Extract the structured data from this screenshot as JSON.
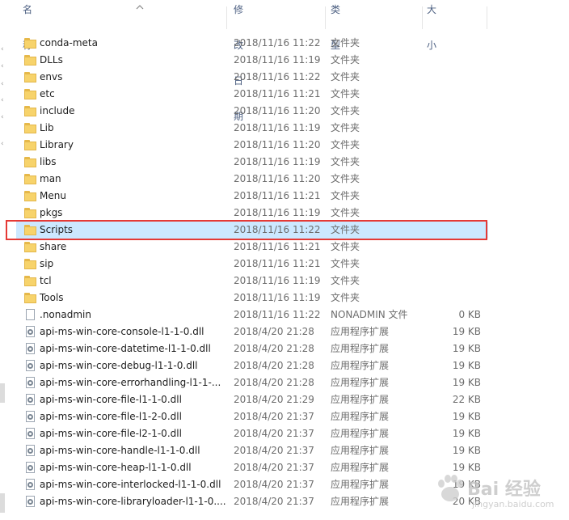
{
  "columns": {
    "name": "名称",
    "date": "修改日期",
    "type": "类型",
    "size": "大小"
  },
  "files": [
    {
      "name": "conda-meta",
      "date": "2018/11/16 11:22",
      "type": "文件夹",
      "size": "",
      "kind": "folder"
    },
    {
      "name": "DLLs",
      "date": "2018/11/16 11:19",
      "type": "文件夹",
      "size": "",
      "kind": "folder"
    },
    {
      "name": "envs",
      "date": "2018/11/16 11:22",
      "type": "文件夹",
      "size": "",
      "kind": "folder"
    },
    {
      "name": "etc",
      "date": "2018/11/16 11:21",
      "type": "文件夹",
      "size": "",
      "kind": "folder"
    },
    {
      "name": "include",
      "date": "2018/11/16 11:20",
      "type": "文件夹",
      "size": "",
      "kind": "folder"
    },
    {
      "name": "Lib",
      "date": "2018/11/16 11:19",
      "type": "文件夹",
      "size": "",
      "kind": "folder"
    },
    {
      "name": "Library",
      "date": "2018/11/16 11:20",
      "type": "文件夹",
      "size": "",
      "kind": "folder"
    },
    {
      "name": "libs",
      "date": "2018/11/16 11:19",
      "type": "文件夹",
      "size": "",
      "kind": "folder"
    },
    {
      "name": "man",
      "date": "2018/11/16 11:20",
      "type": "文件夹",
      "size": "",
      "kind": "folder"
    },
    {
      "name": "Menu",
      "date": "2018/11/16 11:21",
      "type": "文件夹",
      "size": "",
      "kind": "folder"
    },
    {
      "name": "pkgs",
      "date": "2018/11/16 11:19",
      "type": "文件夹",
      "size": "",
      "kind": "folder"
    },
    {
      "name": "Scripts",
      "date": "2018/11/16 11:22",
      "type": "文件夹",
      "size": "",
      "kind": "folder",
      "selected": true
    },
    {
      "name": "share",
      "date": "2018/11/16 11:21",
      "type": "文件夹",
      "size": "",
      "kind": "folder"
    },
    {
      "name": "sip",
      "date": "2018/11/16 11:21",
      "type": "文件夹",
      "size": "",
      "kind": "folder"
    },
    {
      "name": "tcl",
      "date": "2018/11/16 11:19",
      "type": "文件夹",
      "size": "",
      "kind": "folder"
    },
    {
      "name": "Tools",
      "date": "2018/11/16 11:19",
      "type": "文件夹",
      "size": "",
      "kind": "folder"
    },
    {
      "name": ".nonadmin",
      "date": "2018/11/16 11:22",
      "type": "NONADMIN 文件",
      "size": "0 KB",
      "kind": "file"
    },
    {
      "name": "api-ms-win-core-console-l1-1-0.dll",
      "date": "2018/4/20 21:28",
      "type": "应用程序扩展",
      "size": "19 KB",
      "kind": "dll"
    },
    {
      "name": "api-ms-win-core-datetime-l1-1-0.dll",
      "date": "2018/4/20 21:28",
      "type": "应用程序扩展",
      "size": "19 KB",
      "kind": "dll"
    },
    {
      "name": "api-ms-win-core-debug-l1-1-0.dll",
      "date": "2018/4/20 21:28",
      "type": "应用程序扩展",
      "size": "19 KB",
      "kind": "dll"
    },
    {
      "name": "api-ms-win-core-errorhandling-l1-1-...",
      "date": "2018/4/20 21:28",
      "type": "应用程序扩展",
      "size": "19 KB",
      "kind": "dll"
    },
    {
      "name": "api-ms-win-core-file-l1-1-0.dll",
      "date": "2018/4/20 21:29",
      "type": "应用程序扩展",
      "size": "22 KB",
      "kind": "dll"
    },
    {
      "name": "api-ms-win-core-file-l1-2-0.dll",
      "date": "2018/4/20 21:37",
      "type": "应用程序扩展",
      "size": "19 KB",
      "kind": "dll"
    },
    {
      "name": "api-ms-win-core-file-l2-1-0.dll",
      "date": "2018/4/20 21:37",
      "type": "应用程序扩展",
      "size": "19 KB",
      "kind": "dll"
    },
    {
      "name": "api-ms-win-core-handle-l1-1-0.dll",
      "date": "2018/4/20 21:37",
      "type": "应用程序扩展",
      "size": "19 KB",
      "kind": "dll"
    },
    {
      "name": "api-ms-win-core-heap-l1-1-0.dll",
      "date": "2018/4/20 21:37",
      "type": "应用程序扩展",
      "size": "19 KB",
      "kind": "dll"
    },
    {
      "name": "api-ms-win-core-interlocked-l1-1-0.dll",
      "date": "2018/4/20 21:37",
      "type": "应用程序扩展",
      "size": "19 KB",
      "kind": "dll"
    },
    {
      "name": "api-ms-win-core-libraryloader-l1-1-0....",
      "date": "2018/4/20 21:37",
      "type": "应用程序扩展",
      "size": "20 KB",
      "kind": "dll"
    }
  ],
  "watermark": {
    "text": "Bai 经验",
    "url": "jingyan.baidu.com"
  },
  "colors": {
    "selection": "#cce8ff",
    "highlight": "#e53935",
    "header_text": "#4d6082"
  }
}
